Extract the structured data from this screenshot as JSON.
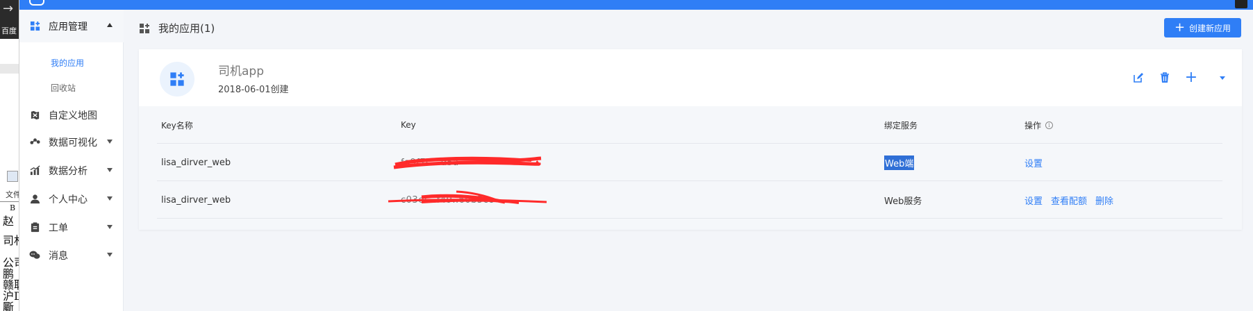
{
  "background_window": {
    "arrow": "→",
    "baidu": "百度",
    "file_menu": "文件",
    "pane_lines": [
      "B",
      "赵",
      "司札",
      "公司",
      "鹏",
      "赣耻",
      "沪D",
      "斸"
    ]
  },
  "sidebar": {
    "items": [
      {
        "label": "应用管理",
        "icon": "grid-plus-icon",
        "expanded": true
      },
      {
        "label": "自定义地图",
        "icon": "map-icon"
      },
      {
        "label": "数据可视化",
        "icon": "visualization-icon"
      },
      {
        "label": "数据分析",
        "icon": "chart-icon"
      },
      {
        "label": "个人中心",
        "icon": "user-icon"
      },
      {
        "label": "工单",
        "icon": "clipboard-icon"
      },
      {
        "label": "消息",
        "icon": "chat-icon"
      }
    ],
    "sub_items": [
      {
        "label": "我的应用",
        "active": true
      },
      {
        "label": "回收站",
        "active": false
      }
    ]
  },
  "page": {
    "title": "我的应用(1)",
    "create_button": "创建新应用"
  },
  "app": {
    "name": "司机app",
    "created": "2018-06-01创建"
  },
  "table": {
    "headers": [
      "Key名称",
      "Key",
      "绑定服务",
      "操作"
    ],
    "rows": [
      {
        "name": "lisa_dirver_web",
        "key": "fa9f7c...d5a",
        "service": "Web端",
        "actions": [
          "设置"
        ]
      },
      {
        "name": "lisa_dirver_web",
        "key": "c03ef...f49..60b5cc",
        "service": "Web服务",
        "actions": [
          "设置",
          "查看配额",
          "删除"
        ]
      }
    ]
  },
  "colors": {
    "accent": "#2f7ef6",
    "redaction": "#ff2a2a"
  }
}
